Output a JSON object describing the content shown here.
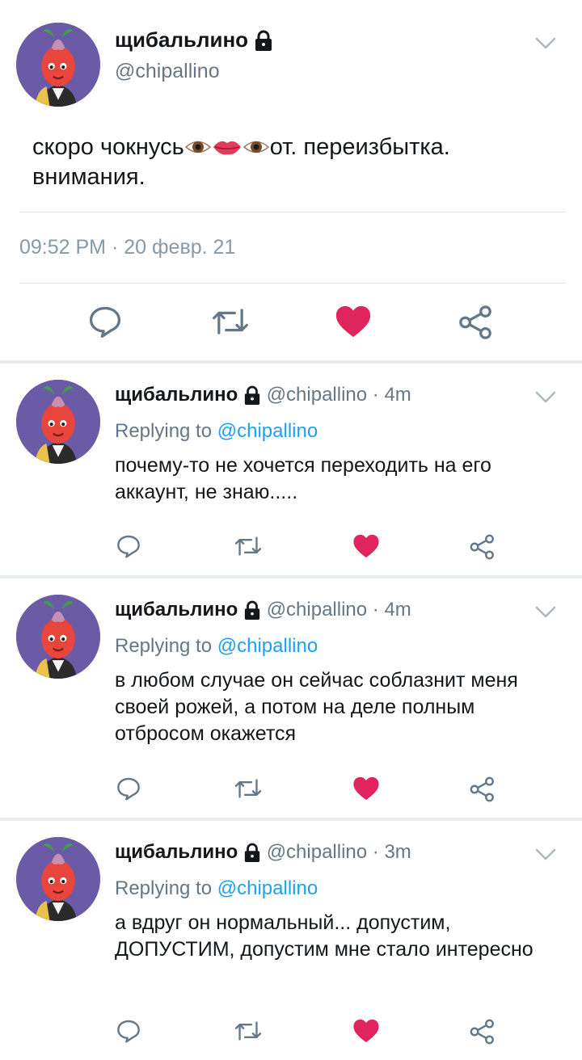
{
  "author": {
    "display_name": "щибальлино",
    "handle": "@chipallino"
  },
  "main_tweet": {
    "text_before": "скоро чокнусь",
    "emojis": [
      "eye",
      "lips",
      "eye"
    ],
    "text_after": "от. переизбытка. внимания.",
    "timestamp": "09:52 PM · 20 февр. 21",
    "liked": true
  },
  "replies": [
    {
      "time": "4m",
      "replying_to_label": "Replying to",
      "replying_to_handle": "@chipallino",
      "text": "почему-то не хочется переходить на его аккаунт, не знаю.....",
      "liked": true
    },
    {
      "time": "4m",
      "replying_to_label": "Replying to",
      "replying_to_handle": "@chipallino",
      "text": "в любом случае он сейчас соблазнит меня своей рожей, а потом на деле полным отбросом окажется",
      "liked": true
    },
    {
      "time": "3m",
      "replying_to_label": "Replying to",
      "replying_to_handle": "@chipallino",
      "text": "а вдруг он нормальный... допустим, ДОПУСТИМ, допустим мне стало интересно",
      "liked": true
    }
  ],
  "separator": " · ",
  "colors": {
    "like": "#e0245e",
    "link": "#1da1f2",
    "muted": "#657786",
    "icon": "#657786",
    "avatar_bg": "#6b5aa6"
  },
  "icons": [
    "reply-icon",
    "retweet-icon",
    "heart-icon",
    "share-icon",
    "lock-icon",
    "chevron-down-icon"
  ]
}
